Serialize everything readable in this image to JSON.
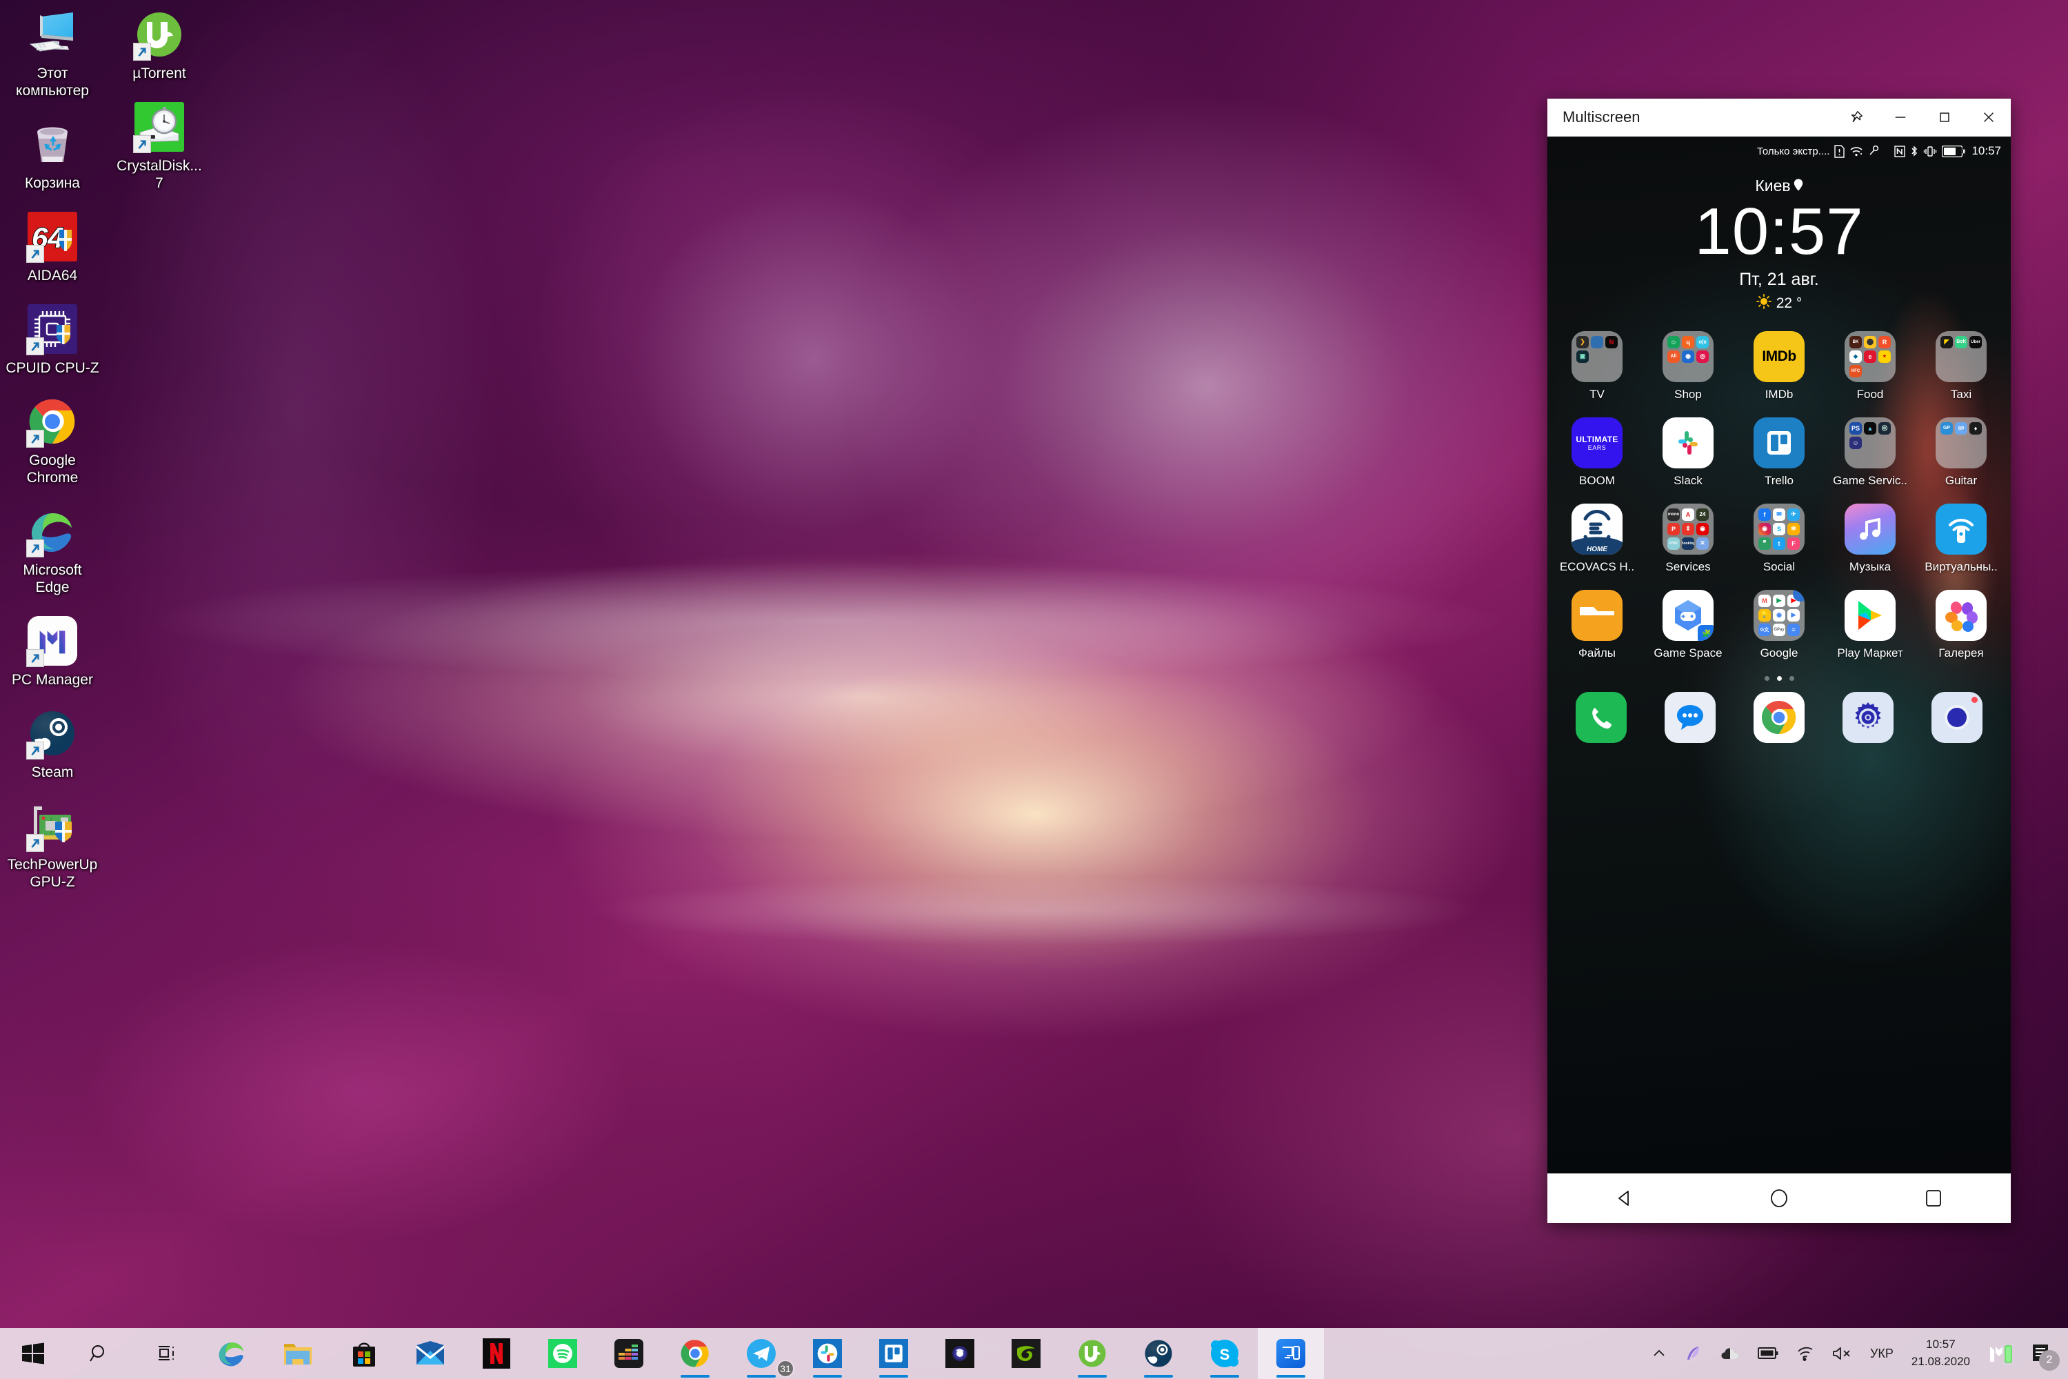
{
  "desktop": {
    "icons": [
      {
        "name": "Этот\nкомпьютер",
        "icon": "this-pc-icon",
        "shortcut": false
      },
      {
        "name": "µTorrent",
        "icon": "utorrent-icon",
        "shortcut": true
      },
      {
        "name": "Корзина",
        "icon": "recycle-bin-icon",
        "shortcut": false
      },
      {
        "name": "CrystalDisk...\n7",
        "icon": "crystaldiskmark-icon",
        "shortcut": true
      },
      {
        "name": "AIDA64",
        "icon": "aida64-icon",
        "shortcut": true
      },
      {
        "name": "CPUID CPU-Z",
        "icon": "cpuz-icon",
        "shortcut": true
      },
      {
        "name": "Google\nChrome",
        "icon": "chrome-icon",
        "shortcut": true
      },
      {
        "name": "Microsoft\nEdge",
        "icon": "edge-icon",
        "shortcut": true
      },
      {
        "name": "PC Manager",
        "icon": "pc-manager-icon",
        "shortcut": true
      },
      {
        "name": "Steam",
        "icon": "steam-icon",
        "shortcut": true
      },
      {
        "name": "TechPowerUp\nGPU-Z",
        "icon": "gpuz-icon",
        "shortcut": true
      }
    ]
  },
  "multiscreen": {
    "title": "Multiscreen",
    "window_buttons": {
      "pin": "pin-icon",
      "minimize": "minimize-icon",
      "maximize": "maximize-icon",
      "close": "close-icon"
    },
    "phone": {
      "statusbar": {
        "carrier": "Только экстр....",
        "battery": "67",
        "time": "10:57",
        "icons": [
          "sim-alert-icon",
          "wifi-icon",
          "vpn-key-icon",
          "nfc-icon",
          "bluetooth-icon",
          "vibrate-icon",
          "battery-icon"
        ]
      },
      "clock_widget": {
        "city": "Киев",
        "location_icon": "location-pin-icon",
        "time": "10:57",
        "date": "Пт, 21 авг.",
        "weather_icon": "sun-icon",
        "temperature": "22 °"
      },
      "app_rows": [
        [
          {
            "label": "TV",
            "type": "folder",
            "minis": [
              "ivi",
              "mega",
              "N",
              "kino",
              "",
              ""
            ],
            "colors": [
              "#2b2b2b",
              "#2f6fb0",
              "#0b0b0b",
              "#0e2a33",
              "",
              ""
            ]
          },
          {
            "label": "Shop",
            "type": "folder",
            "minis": [
              "R",
              "ц",
              "o|x",
              "Ali",
              "V",
              "T"
            ],
            "colors": [
              "#15a35b",
              "#f4641e",
              "#2ec2e6",
              "#f05a28",
              "#1f6bd0",
              "#e0154b"
            ]
          },
          {
            "label": "IMDb",
            "type": "app",
            "icon": "imdb-icon"
          },
          {
            "label": "Food",
            "type": "folder",
            "minis": [
              "BK",
              "G",
              "R",
              "D",
              "e",
              "S",
              "KFC",
              "",
              ""
            ],
            "colors": [
              "#4a1f14",
              "#ffc522",
              "#f2502a",
              "#ffffff",
              "#e0152f",
              "#ffd200",
              "#e5511f",
              "",
              ""
            ]
          },
          {
            "label": "Taxi",
            "type": "folder",
            "minis": [
              "U",
              "Bolt",
              "Uber",
              "",
              "",
              ""
            ],
            "colors": [
              "#1a1a1a",
              "#34d186",
              "#0b0b0b",
              "",
              "",
              ""
            ]
          }
        ],
        [
          {
            "label": "BOOM",
            "type": "app",
            "icon": "ultimate-ears-boom-icon",
            "text": "ULTIMATE\nEARS"
          },
          {
            "label": "Slack",
            "type": "app",
            "icon": "slack-icon"
          },
          {
            "label": "Trello",
            "type": "app",
            "icon": "trello-icon"
          },
          {
            "label": "Game Servic..",
            "type": "folder",
            "minis": [
              "PS",
              "E",
              "S",
              "D",
              "",
              ""
            ],
            "colors": [
              "#1d4ea8",
              "#0b0b0b",
              "#1b2838",
              "#2b2f7a",
              "",
              ""
            ]
          },
          {
            "label": "Guitar",
            "type": "folder",
            "minis": [
              "GP",
              "gp",
              "T",
              "",
              "",
              ""
            ],
            "colors": [
              "#2b8ed6",
              "#6ba7ef",
              "#1c1c1c",
              "",
              "",
              ""
            ]
          }
        ],
        [
          {
            "label": "ECOVACS H..",
            "type": "app",
            "icon": "ecovacs-home-icon"
          },
          {
            "label": "Services",
            "type": "folder",
            "minis": [
              "mono",
              "A",
              "24",
              "P",
              "H",
              "V",
              "KYIV",
              "B",
              "X"
            ],
            "colors": [
              "#2b2b2b",
              "#ffffff",
              "#2f3a24",
              "#e8362b",
              "#e8362b",
              "#e60000",
              "#8fd0d8",
              "#16355f",
              "#7ba7e8"
            ]
          },
          {
            "label": "Social",
            "type": "folder",
            "minis": [
              "f",
              "M",
              "T",
              "I",
              "S",
              "W",
              "V",
              "t",
              "F"
            ],
            "colors": [
              "#1877f2",
              "#ffffff",
              "#2aabee",
              "#e1306c",
              "#ffffff",
              "#ffb100",
              "#2c9e63",
              "#1da1f2",
              "#f94877"
            ]
          },
          {
            "label": "Музыка",
            "type": "app",
            "icon": "music-icon"
          },
          {
            "label": "Виртуальны..",
            "type": "app",
            "icon": "virtual-remote-icon"
          }
        ],
        [
          {
            "label": "Файлы",
            "type": "app",
            "icon": "files-icon"
          },
          {
            "label": "Game Space",
            "type": "app",
            "icon": "game-space-icon"
          },
          {
            "label": "Google",
            "type": "folder",
            "minis": [
              "M",
              "P",
              "YT",
              "K",
              "Maps",
              "PM",
              "Tr",
              "Pay",
              "Docs"
            ],
            "colors": [
              "#ffffff",
              "#ffffff",
              "#ffffff",
              "#ffc107",
              "#ffffff",
              "#ffffff",
              "#4285f4",
              "#ffffff",
              "#4285f4"
            ],
            "badge": true
          },
          {
            "label": "Play Маркет",
            "type": "app",
            "icon": "play-store-icon"
          },
          {
            "label": "Галерея",
            "type": "app",
            "icon": "gallery-icon"
          }
        ]
      ],
      "page_dots": {
        "count": 3,
        "active": 1
      },
      "dock": [
        {
          "name": "phone-dialer-icon"
        },
        {
          "name": "messages-icon"
        },
        {
          "name": "chrome-icon"
        },
        {
          "name": "settings-icon"
        },
        {
          "name": "camera-icon",
          "badge": true
        }
      ],
      "navbar": [
        "back-button",
        "home-button",
        "recents-button"
      ]
    }
  },
  "taskbar": {
    "buttons": [
      {
        "name": "start-button",
        "icon": "windows-logo-icon",
        "running": false
      },
      {
        "name": "search-button",
        "icon": "search-icon",
        "running": false
      },
      {
        "name": "task-view-button",
        "icon": "task-view-icon",
        "running": false
      },
      {
        "name": "taskbar-edge",
        "icon": "edge-icon",
        "running": false
      },
      {
        "name": "taskbar-file-explorer",
        "icon": "file-explorer-icon",
        "running": false
      },
      {
        "name": "taskbar-microsoft-store",
        "icon": "microsoft-store-icon",
        "running": false
      },
      {
        "name": "taskbar-mail",
        "icon": "mail-icon",
        "running": false
      },
      {
        "name": "taskbar-netflix",
        "icon": "netflix-icon",
        "running": false
      },
      {
        "name": "taskbar-spotify",
        "icon": "spotify-icon",
        "running": false
      },
      {
        "name": "taskbar-deezer",
        "icon": "deezer-icon",
        "running": false
      },
      {
        "name": "taskbar-chrome",
        "icon": "chrome-icon",
        "running": true
      },
      {
        "name": "taskbar-telegram",
        "icon": "telegram-icon",
        "running": true,
        "badge": "31"
      },
      {
        "name": "taskbar-slack",
        "icon": "slack-icon",
        "running": true
      },
      {
        "name": "taskbar-trello",
        "icon": "trello-icon",
        "running": true
      },
      {
        "name": "taskbar-aimp",
        "icon": "aimp-icon",
        "running": false
      },
      {
        "name": "taskbar-nvidia",
        "icon": "nvidia-icon",
        "running": false
      },
      {
        "name": "taskbar-utorrent",
        "icon": "utorrent-icon",
        "running": true
      },
      {
        "name": "taskbar-steam",
        "icon": "steam-icon",
        "running": true
      },
      {
        "name": "taskbar-skype",
        "icon": "skype-icon",
        "running": true
      },
      {
        "name": "taskbar-multiscreen",
        "icon": "multiscreen-icon",
        "running": true,
        "active": true
      }
    ],
    "tray": {
      "show_hidden": "chevron-up-icon",
      "items": [
        {
          "name": "feather-icon"
        },
        {
          "name": "onedrive-icon"
        },
        {
          "name": "battery-icon"
        },
        {
          "name": "network-icon"
        },
        {
          "name": "volume-muted-icon"
        }
      ],
      "language": "УКР",
      "time": "10:57",
      "date": "21.08.2020",
      "pc-manager": "pc-manager-tray-icon",
      "notifications": {
        "icon": "action-center-icon",
        "count": "2"
      }
    }
  }
}
